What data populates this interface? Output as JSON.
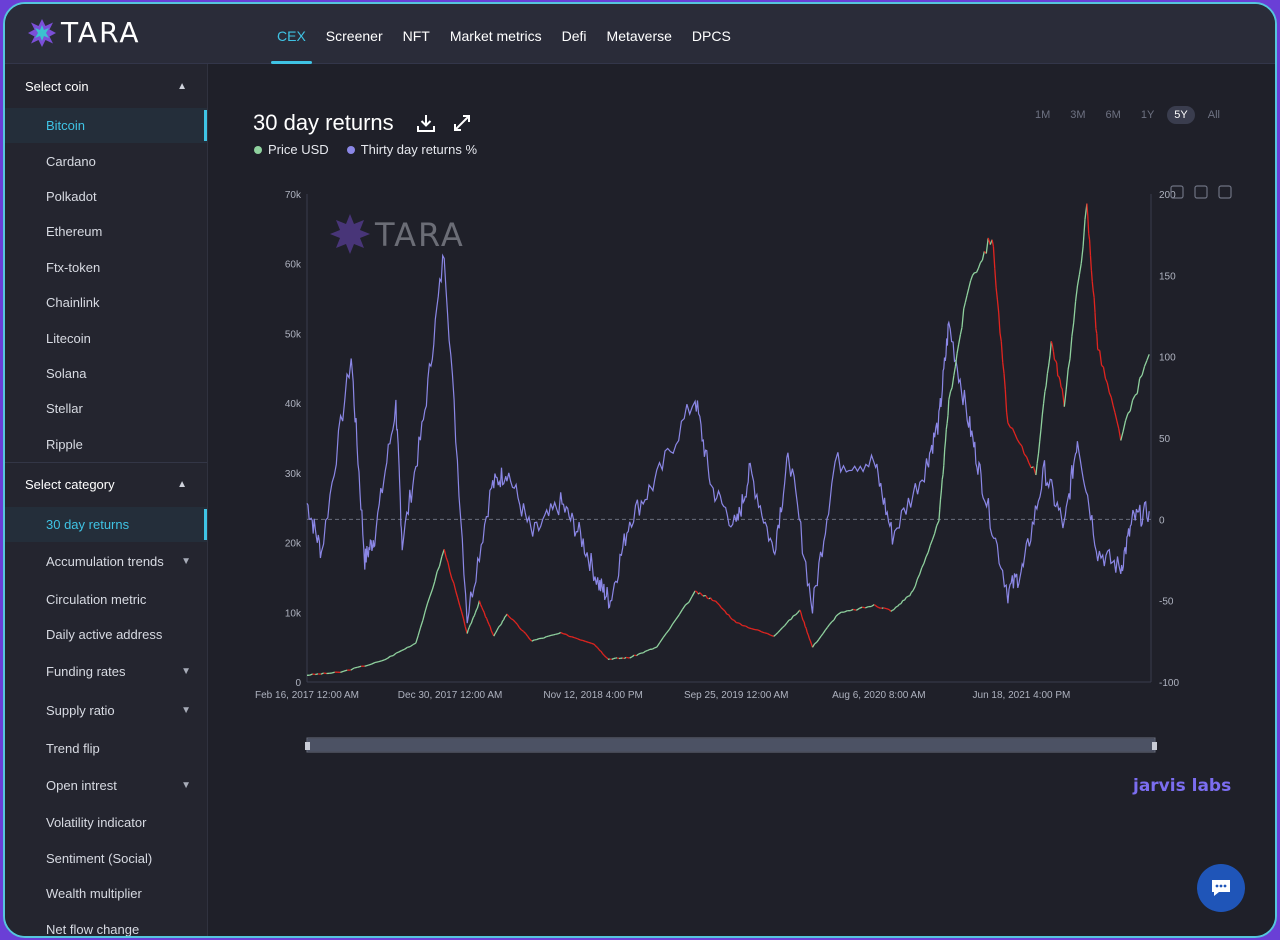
{
  "app": {
    "name": "TARA"
  },
  "nav": {
    "items": [
      "CEX",
      "Screener",
      "NFT",
      "Market metrics",
      "Defi",
      "Metaverse",
      "DPCS"
    ],
    "active": "CEX"
  },
  "sidebar": {
    "coin_section": "Select coin",
    "coins": [
      "Bitcoin",
      "Cardano",
      "Polkadot",
      "Ethereum",
      "Ftx-token",
      "Chainlink",
      "Litecoin",
      "Solana",
      "Stellar",
      "Ripple"
    ],
    "category_section": "Select category",
    "categories": [
      {
        "label": "30 day returns",
        "expandable": false
      },
      {
        "label": "Accumulation trends",
        "expandable": true
      },
      {
        "label": "Circulation metric",
        "expandable": false
      },
      {
        "label": "Daily active address",
        "expandable": false
      },
      {
        "label": "Funding rates",
        "expandable": true
      },
      {
        "label": "Supply ratio",
        "expandable": true
      },
      {
        "label": "Trend flip",
        "expandable": false
      },
      {
        "label": "Open intrest",
        "expandable": true
      },
      {
        "label": "Volatility indicator",
        "expandable": false
      },
      {
        "label": "Sentiment (Social)",
        "expandable": false
      },
      {
        "label": "Wealth multiplier",
        "expandable": false
      },
      {
        "label": "Net flow change",
        "expandable": false
      }
    ]
  },
  "chart_header": {
    "title": "30 day returns",
    "ranges": [
      "1M",
      "3M",
      "6M",
      "1Y",
      "5Y",
      "All"
    ],
    "active_range": "5Y"
  },
  "watermarks": {
    "chart_logo": "TARA",
    "jarvis": "jarvis labs"
  },
  "colors": {
    "accent": "#3fc3e4",
    "price_up": "#8fd19e",
    "price_down": "#e0241f",
    "returns_line": "#8b87e6",
    "background": "#1f2029"
  },
  "chart_data": {
    "type": "line",
    "title": "30 day returns",
    "x_tick_labels": [
      "Feb 16, 2017 12:00 AM",
      "Dec 30, 2017 12:00 AM",
      "Nov 12, 2018 4:00 PM",
      "Sep 25, 2019 12:00 AM",
      "Aug 6, 2020 8:00 AM",
      "Jun 18, 2021 4:00 PM"
    ],
    "y_left": {
      "ticks": [
        "0",
        "10k",
        "20k",
        "30k",
        "40k",
        "50k",
        "60k",
        "70k"
      ],
      "range": [
        0,
        70000
      ]
    },
    "y_right": {
      "ticks": [
        "-100",
        "-50",
        "0",
        "50",
        "100",
        "150",
        "200"
      ],
      "range": [
        -100,
        200
      ]
    },
    "grid": false,
    "legend": "top-left",
    "series": [
      {
        "name": "Price USD",
        "axis": "left",
        "x": [
          "2017-02-16",
          "2017-05-01",
          "2017-08-01",
          "2017-10-15",
          "2017-12-17",
          "2018-02-06",
          "2018-03-05",
          "2018-04-06",
          "2018-05-05",
          "2018-06-29",
          "2018-09-01",
          "2018-11-14",
          "2018-12-15",
          "2019-02-01",
          "2019-04-02",
          "2019-06-26",
          "2019-08-06",
          "2019-09-25",
          "2019-12-17",
          "2020-02-13",
          "2020-03-12",
          "2020-05-08",
          "2020-07-27",
          "2020-09-05",
          "2020-10-21",
          "2020-12-17",
          "2021-01-08",
          "2021-02-21",
          "2021-04-14",
          "2021-05-19",
          "2021-07-20",
          "2021-08-23",
          "2021-09-21",
          "2021-11-10",
          "2021-12-04",
          "2022-01-24",
          "2022-03-28"
        ],
        "y": [
          1000,
          1400,
          3000,
          5600,
          19000,
          7000,
          11500,
          6600,
          9800,
          5900,
          7000,
          5500,
          3300,
          3500,
          5000,
          12900,
          11800,
          8500,
          6600,
          10300,
          5000,
          9800,
          11000,
          10200,
          13000,
          23000,
          40000,
          57000,
          64000,
          37000,
          30000,
          49000,
          40000,
          68000,
          48000,
          35000,
          47000
        ],
        "color_rule": "green when rising, red when falling"
      },
      {
        "name": "Thirty day returns %",
        "axis": "right",
        "x": [
          "2017-02-16",
          "2017-03-20",
          "2017-05-25",
          "2017-06-24",
          "2017-07-16",
          "2017-09-01",
          "2017-09-15",
          "2017-11-01",
          "2017-12-17",
          "2018-02-06",
          "2018-04-01",
          "2018-05-05",
          "2018-07-01",
          "2018-09-01",
          "2018-10-15",
          "2018-11-25",
          "2018-12-20",
          "2019-02-01",
          "2019-04-02",
          "2019-06-26",
          "2019-08-01",
          "2019-09-25",
          "2019-10-26",
          "2019-12-17",
          "2020-01-20",
          "2020-03-12",
          "2020-05-01",
          "2020-07-27",
          "2020-09-05",
          "2020-11-15",
          "2020-12-17",
          "2021-01-08",
          "2021-02-21",
          "2021-03-25",
          "2021-05-19",
          "2021-06-22",
          "2021-08-08",
          "2021-09-21",
          "2021-10-20",
          "2021-12-04",
          "2022-01-24",
          "2022-02-20",
          "2022-03-28"
        ],
        "y": [
          10,
          -20,
          100,
          -25,
          -10,
          70,
          -15,
          60,
          165,
          -60,
          20,
          30,
          -10,
          10,
          -10,
          -40,
          -50,
          0,
          25,
          75,
          20,
          -5,
          30,
          -20,
          40,
          -55,
          35,
          35,
          -10,
          30,
          60,
          120,
          60,
          20,
          -45,
          -30,
          30,
          -5,
          50,
          -20,
          -30,
          0,
          5
        ]
      }
    ]
  }
}
